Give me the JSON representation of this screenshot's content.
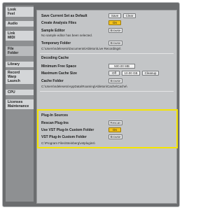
{
  "sidebar": {
    "tabs": [
      {
        "lines": [
          "Look",
          "Feel"
        ]
      },
      {
        "lines": [
          "Audio"
        ]
      },
      {
        "lines": [
          "Link",
          "MIDI"
        ]
      },
      {
        "lines": [
          "File",
          "Folder"
        ]
      },
      {
        "lines": [
          "Library"
        ]
      },
      {
        "lines": [
          "Record",
          "Warp",
          "Launch"
        ]
      },
      {
        "lines": [
          "CPU"
        ]
      },
      {
        "lines": [
          "Licenses",
          "Maintenance"
        ]
      }
    ]
  },
  "top": {
    "save_set_label": "Save Current Set as Default",
    "save_button": "Save",
    "clear_button": "Clear",
    "create_analysis_label": "Create Analysis Files",
    "create_analysis_value": "On",
    "sample_editor_label": "Sample Editor",
    "sample_editor_button": "Browse",
    "sample_editor_status": "No sample editor has been selected.",
    "temp_folder_label": "Temporary Folder",
    "temp_folder_button": "Browse",
    "temp_folder_path": "C:\\Users\\ndeleseto\\Documents\\Ableton\\Live Recordings\\"
  },
  "decoding_cache": {
    "title": "Decoding Cache",
    "min_free_label": "Minimum Free Space",
    "min_free_value": "500.00 MB",
    "max_size_label": "Maximum Cache Size",
    "max_size_toggle": "Off",
    "max_size_value": "10.00 GB",
    "cleanup_button": "Cleanup",
    "cache_folder_label": "Cache Folder",
    "cache_folder_button": "Browse",
    "cache_folder_path": "C:\\Users\\ndeleseto\\AppData\\Roaming\\Ableton\\Cache\\Cache\\"
  },
  "plugin_sources": {
    "title": "Plug-In Sources",
    "rescan_label": "Rescan Plug-Ins",
    "rescan_button": "Rescan",
    "use_vst_label": "Use VST Plug-In Custom Folder",
    "use_vst_value": "On",
    "vst_folder_label": "VST Plug-In Custom Folder",
    "vst_folder_button": "Browse",
    "vst_folder_path": "C:\\Program Files\\Steinberg\\vstplugins\\"
  },
  "colors": {
    "toggle_on": "#f4c21a",
    "highlight": "#f5e500",
    "panel": "#c3c5c7",
    "sidebar": "#8e9092"
  }
}
